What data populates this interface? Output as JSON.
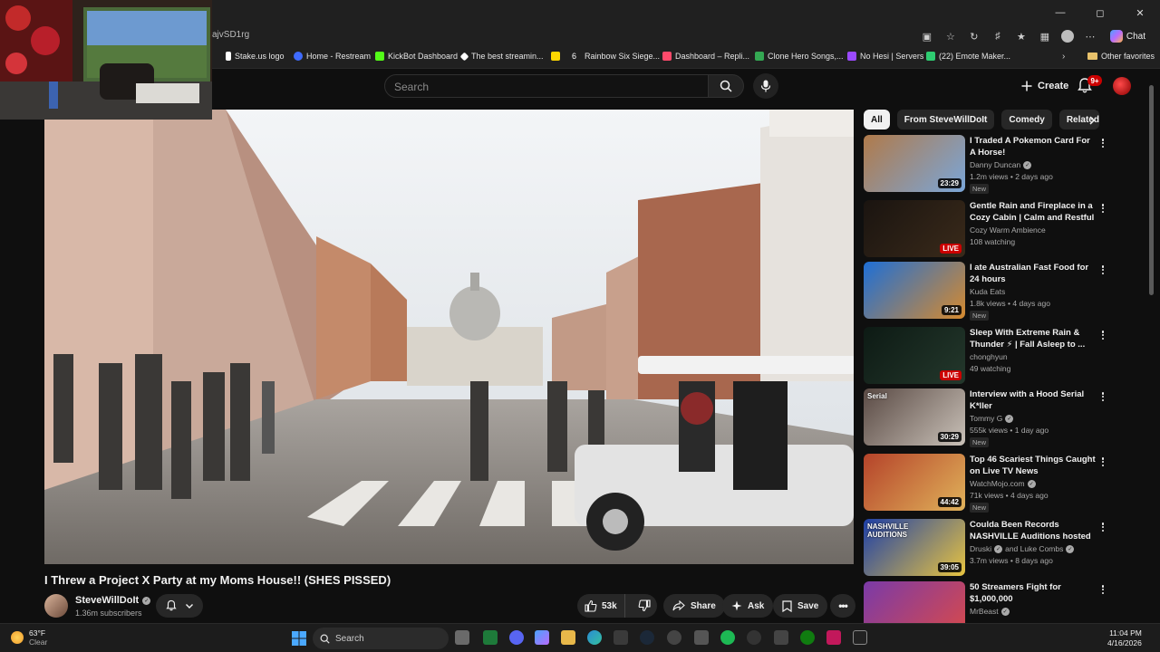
{
  "browser": {
    "url_fragment": "ajvSD1rg",
    "chat_label": "Chat",
    "bookmarks": [
      {
        "label": "Stake.us logo",
        "color": "#ffffff"
      },
      {
        "label": "Home - Restream",
        "color": "#3f6bff"
      },
      {
        "label": "KickBot Dashboard",
        "color": "#53fc18"
      },
      {
        "label": "The best streamin...",
        "color": "#ffffff"
      },
      {
        "label": "",
        "color": "#ffd700"
      },
      {
        "label": "Rainbow Six Siege...",
        "color": "#ffffff"
      },
      {
        "label": "Dashboard – Repli...",
        "color": "#ff4a6b"
      },
      {
        "label": "Clone Hero Songs,...",
        "color": "#34a853"
      },
      {
        "label": "No Hesi | Servers",
        "color": "#9b4aff"
      },
      {
        "label": "(22) Emote Maker...",
        "color": "#2ecc71"
      }
    ],
    "other_favorites": "Other favorites"
  },
  "youtube": {
    "search_placeholder": "Search",
    "create_label": "Create",
    "notification_count": "9+"
  },
  "video": {
    "title": "I Threw a Project X Party at my Moms House!! (SHES PISSED)",
    "channel": "SteveWillDoIt",
    "subscribers": "1.36m subscribers",
    "likes": "53k",
    "share_label": "Share",
    "ask_label": "Ask",
    "save_label": "Save"
  },
  "sidebar": {
    "chips": [
      "All",
      "From SteveWillDoIt",
      "Comedy",
      "Related"
    ],
    "recommendations": [
      {
        "title": "I Traded A Pokemon Card For A Horse!",
        "channel": "Danny Duncan",
        "verified": true,
        "meta": "1.2m views • 2 days ago",
        "badge": "New",
        "duration": "23:29",
        "live": false,
        "thumb_colors": [
          "#b07a4a",
          "#7aa6d9"
        ]
      },
      {
        "title": "Gentle Rain and Fireplace in a Cozy Cabin | Calm and Restful ...",
        "channel": "Cozy Warm Ambience",
        "verified": false,
        "meta": "108 watching",
        "badge": "",
        "duration": "LIVE",
        "live": true,
        "thumb_colors": [
          "#1a1410",
          "#3a2a1a"
        ]
      },
      {
        "title": "I ate Australian Fast Food for 24 hours",
        "channel": "Kuda Eats",
        "verified": false,
        "meta": "1.8k views • 4 days ago",
        "badge": "New",
        "duration": "9:21",
        "live": false,
        "thumb_colors": [
          "#1e6fd6",
          "#d68a2e"
        ]
      },
      {
        "title": "Sleep With Extreme Rain & Thunder ⚡ | Fall Asleep to ...",
        "channel": "chonghyun",
        "verified": false,
        "meta": "49 watching",
        "badge": "",
        "duration": "LIVE",
        "live": true,
        "thumb_colors": [
          "#0d1a14",
          "#24382c"
        ]
      },
      {
        "title": "Interview with a Hood Serial K*ller",
        "channel": "Tommy G",
        "verified": true,
        "meta": "555k views • 1 day ago",
        "badge": "New",
        "duration": "30:29",
        "live": false,
        "thumb_colors": [
          "#5a4a44",
          "#c9c1b8"
        ],
        "thumb_text": "Serial"
      },
      {
        "title": "Top 46 Scariest Things Caught on Live TV News",
        "channel": "WatchMojo.com",
        "verified": true,
        "meta": "71k views • 4 days ago",
        "badge": "New",
        "duration": "44:42",
        "live": false,
        "thumb_colors": [
          "#b5432a",
          "#e0b25a"
        ]
      },
      {
        "title": "Coulda Been Records NASHVILLE Auditions hosted ...",
        "channel": "Druski",
        "channel_extra": "and Luke Combs",
        "verified": true,
        "meta": "3.7m views • 8 days ago",
        "badge": "",
        "duration": "39:05",
        "live": false,
        "thumb_colors": [
          "#1d3fa8",
          "#e8c440"
        ],
        "thumb_text": "NASHVILLE AUDITIONS"
      },
      {
        "title": "50 Streamers Fight for $1,000,000",
        "channel": "MrBeast",
        "verified": true,
        "meta": "",
        "badge": "",
        "duration": "",
        "live": false,
        "thumb_colors": [
          "#7a3aa8",
          "#d94a4a"
        ]
      }
    ]
  },
  "taskbar": {
    "temp": "63°F",
    "condition": "Clear",
    "search_label": "Search",
    "time": "11:04 PM",
    "date": "4/16/2026"
  }
}
